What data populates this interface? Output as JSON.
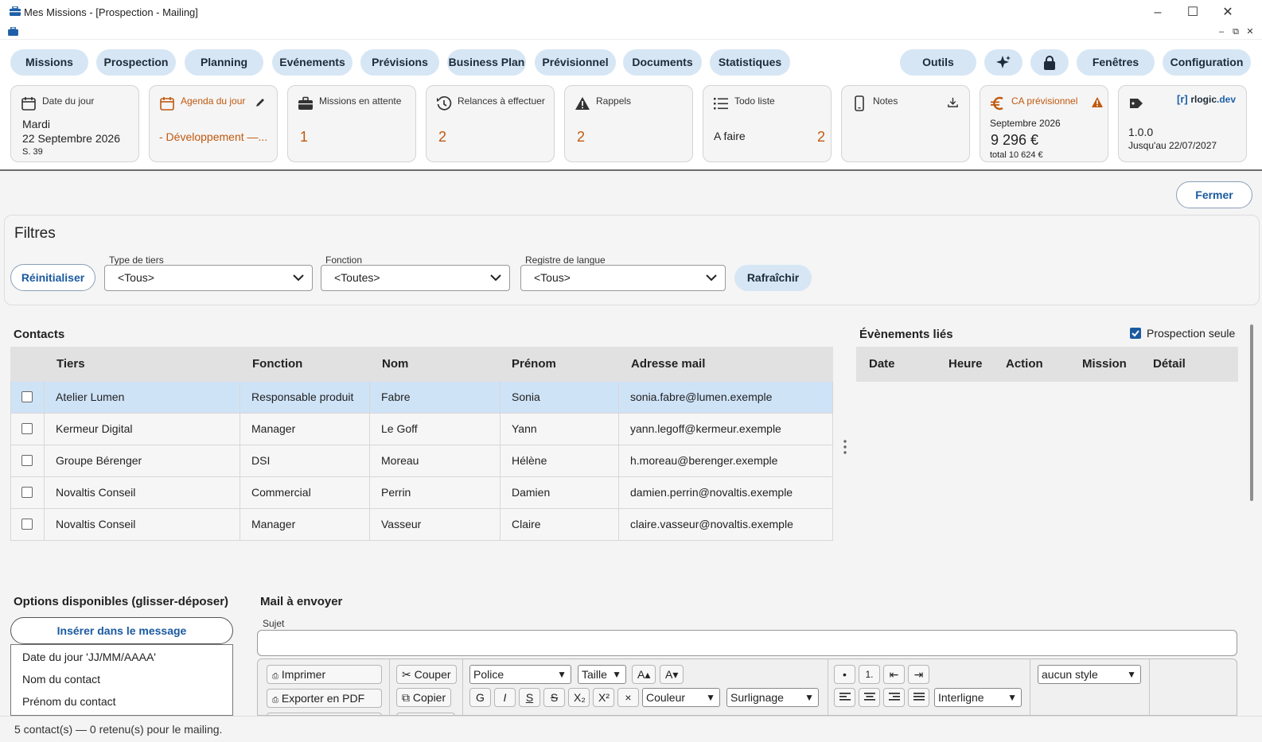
{
  "window": {
    "title": "Mes Missions - [Prospection - Mailing]"
  },
  "menu": {
    "items": [
      "Missions",
      "Prospection",
      "Planning",
      "Evénements",
      "Prévisions",
      "Business Plan",
      "Prévisionnel",
      "Documents",
      "Statistiques"
    ],
    "right": [
      "Outils",
      "Fenêtres",
      "Configuration"
    ]
  },
  "dashboard": {
    "date": {
      "label": "Date du jour",
      "day": "Mardi",
      "date": "22 Septembre 2026",
      "week": "S. 39"
    },
    "agenda": {
      "label": "Agenda du jour",
      "value": "- Développement —..."
    },
    "missions": {
      "label": "Missions en attente",
      "value": "1"
    },
    "relances": {
      "label": "Relances à effectuer",
      "value": "2"
    },
    "rappels": {
      "label": "Rappels",
      "value": "2"
    },
    "todo": {
      "label": "Todo liste",
      "item": "A faire",
      "value": "2"
    },
    "notes": {
      "label": "Notes"
    },
    "ca": {
      "label": "CA prévisionnel",
      "month": "Septembre 2026",
      "amount": "9 296 €",
      "total": "total 10 624 €"
    },
    "license": {
      "brand_bracket": "[r]",
      "brand": "rlogic",
      "brand_tld": ".dev",
      "version": "1.0.0",
      "until": "Jusqu'au 22/07/2027"
    }
  },
  "actions": {
    "close": "Fermer"
  },
  "filters": {
    "title": "Filtres",
    "reset": "Réinitialiser",
    "type_label": "Type de tiers",
    "type_value": "<Tous>",
    "fonction_label": "Fonction",
    "fonction_value": "<Toutes>",
    "langue_label": "Registre de langue",
    "langue_value": "<Tous>",
    "refresh": "Rafraîchir"
  },
  "contacts": {
    "title": "Contacts",
    "columns": [
      "Tiers",
      "Fonction",
      "Nom",
      "Prénom",
      "Adresse mail"
    ],
    "rows": [
      [
        "Atelier Lumen",
        "Responsable produit",
        "Fabre",
        "Sonia",
        "sonia.fabre@lumen.exemple"
      ],
      [
        "Kermeur Digital",
        "Manager",
        "Le Goff",
        "Yann",
        "yann.legoff@kermeur.exemple"
      ],
      [
        "Groupe Bérenger",
        "DSI",
        "Moreau",
        "Hélène",
        "h.moreau@berenger.exemple"
      ],
      [
        "Novaltis Conseil",
        "Commercial",
        "Perrin",
        "Damien",
        "damien.perrin@novaltis.exemple"
      ],
      [
        "Novaltis Conseil",
        "Manager",
        "Vasseur",
        "Claire",
        "claire.vasseur@novaltis.exemple"
      ]
    ]
  },
  "events": {
    "title": "Évènements liés",
    "prospection_only": "Prospection seule",
    "columns": [
      "Date",
      "Heure",
      "Action",
      "Mission",
      "Détail"
    ]
  },
  "options": {
    "title": "Options disponibles (glisser-déposer)",
    "insert": "Insérer dans le message",
    "items": [
      "Date du jour 'JJ/MM/AAAA'",
      "Nom du contact",
      "Prénom du contact"
    ]
  },
  "mail": {
    "title": "Mail à envoyer",
    "subject_label": "Sujet",
    "toolbar": {
      "print": "Imprimer",
      "pdf": "Exporter en PDF",
      "cut": "Couper",
      "copy": "Copier",
      "font": "Police",
      "size": "Taille",
      "grow": "A▴",
      "shrink": "A▾",
      "bold": "G",
      "italic": "I",
      "underline": "S",
      "strike": "S",
      "sub": "X₂",
      "sup": "X²",
      "clear": "×",
      "color": "Couleur",
      "highlight": "Surlignage",
      "bullet": "•",
      "numbered": "1.",
      "outdent": "⇤",
      "indent": "⇥",
      "line_spacing": "Interligne",
      "style": "aucun style"
    }
  },
  "status": {
    "text": "5 contact(s) — 0 retenu(s) pour le mailing."
  }
}
